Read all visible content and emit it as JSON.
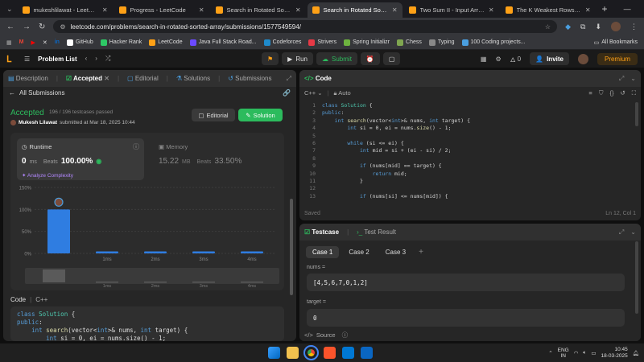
{
  "browser": {
    "tabs": [
      {
        "title": "mukeshlilawat - LeetCode",
        "color": "#ffa116",
        "active": false
      },
      {
        "title": "Progress - LeetCode",
        "color": "#ffa116",
        "active": false
      },
      {
        "title": "Search in Rotated Sorted A",
        "color": "#ffa116",
        "active": false
      },
      {
        "title": "Search in Rotated Sorted A",
        "color": "#ffa116",
        "active": true
      },
      {
        "title": "Two Sum II - Input Array Is",
        "color": "#ffa116",
        "active": false
      },
      {
        "title": "The K Weakest Rows in a M",
        "color": "#ffa116",
        "active": false
      }
    ],
    "url": "leetcode.com/problems/search-in-rotated-sorted-array/submissions/1577549594/",
    "bookmarks": [
      "GitHub",
      "Hacker Rank",
      "LeetCode",
      "Java Full Stack Road...",
      "Codeforces",
      "Strivers",
      "Spring Initializr",
      "Chess",
      "Typing",
      "100 Coding projects..."
    ],
    "all_bookmarks": "All Bookmarks"
  },
  "lcnav": {
    "problem_list": "Problem List",
    "run": "Run",
    "submit": "Submit",
    "fire_count": "0",
    "invite": "Invite",
    "premium": "Premium"
  },
  "left": {
    "tabs": [
      "Description",
      "Accepted",
      "Editorial",
      "Solutions",
      "Submissions"
    ],
    "all_submissions": "All Submissions",
    "status": "Accepted",
    "testcases": "196 / 196 testcases passed",
    "author": "Mukesh Lilawat",
    "submitted": "submitted at Mar 18, 2025 10:44",
    "editorial_btn": "Editorial",
    "solution_btn": "Solution",
    "runtime": {
      "label": "Runtime",
      "value": "0",
      "unit": "ms",
      "beats_label": "Beats",
      "beats": "100.00%",
      "analyze": "Analyze Complexity"
    },
    "memory": {
      "label": "Memory",
      "value": "15.22",
      "unit": "MB",
      "beats_label": "Beats",
      "beats": "33.50%"
    },
    "code_label": "Code",
    "code_lang": "C++"
  },
  "chart_data": {
    "type": "bar",
    "categories": [
      "0ms",
      "1ms",
      "2ms",
      "3ms",
      "4ms"
    ],
    "tick_labels": [
      "",
      "1ms",
      "2ms",
      "3ms",
      "4ms"
    ],
    "values": [
      100,
      2,
      2,
      2,
      2
    ],
    "ylabels": [
      "150%",
      "100%",
      "50%",
      "0%"
    ],
    "ylim": [
      0,
      150
    ],
    "bar_color": "#2f7de1"
  },
  "editor": {
    "title": "Code",
    "lang": "C++",
    "mode": "Auto",
    "saved": "Saved",
    "position": "Ln 12, Col 1",
    "line_numbers": [
      "1",
      "2",
      "3",
      "4",
      "5",
      "6",
      "7",
      "8",
      "9",
      "10",
      "11",
      "12",
      "13"
    ]
  },
  "testcase": {
    "tab": "Testcase",
    "result_tab": "Test Result",
    "cases": [
      "Case 1",
      "Case 2",
      "Case 3"
    ],
    "vars": [
      {
        "name": "nums =",
        "value": "[4,5,6,7,0,1,2]"
      },
      {
        "name": "target =",
        "value": "0"
      }
    ],
    "source": "Source"
  },
  "taskbar": {
    "lang1": "ENG",
    "lang2": "IN",
    "time": "10:45",
    "date": "18-03-2025"
  }
}
